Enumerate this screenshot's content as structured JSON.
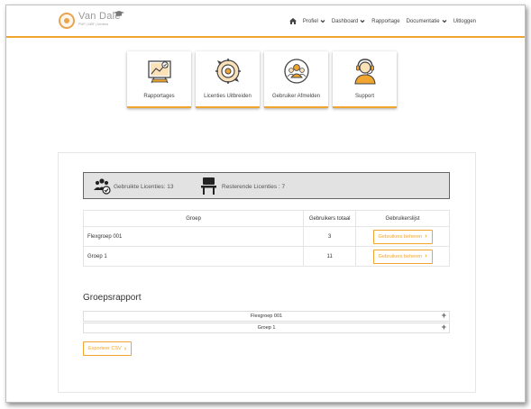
{
  "header": {
    "logo_name": "Van Dale",
    "logo_sub": "PMR | MBF | Adviesa",
    "nav": [
      {
        "label": "Profiel",
        "has_dropdown": true
      },
      {
        "label": "Dashboard",
        "has_dropdown": true
      },
      {
        "label": "Rapportage",
        "has_dropdown": false
      },
      {
        "label": "Documentatie",
        "has_dropdown": true
      },
      {
        "label": "Uitloggen",
        "has_dropdown": false
      }
    ]
  },
  "tiles": [
    {
      "label": "Rapportages",
      "icon": "report-board-icon"
    },
    {
      "label": "Licenties Uitbreiden",
      "icon": "refresh-gear-icon"
    },
    {
      "label": "Gebruiker Afmelden",
      "icon": "users-circle-icon"
    },
    {
      "label": "Support",
      "icon": "headset-support-icon"
    }
  ],
  "licenses": {
    "used_label": "Gebruikte Licenties: 13",
    "remaining_label": "Resterende Licenties : 7"
  },
  "groups_table": {
    "headers": [
      "Groep",
      "Gebruikers totaal",
      "Gebruikerslijst"
    ],
    "rows": [
      {
        "name": "Flexgroep 001",
        "total": "3",
        "action": "Gebruikers beheren"
      },
      {
        "name": "Groep 1",
        "total": "11",
        "action": "Gebruikers beheren"
      }
    ]
  },
  "report": {
    "title": "Groepsrapport",
    "items": [
      "Flexgroep 001",
      "Groep 1"
    ],
    "export_label": "Exporteer CSV"
  },
  "colors": {
    "accent": "#f0a530",
    "license_bar": "#e2e2e2"
  }
}
